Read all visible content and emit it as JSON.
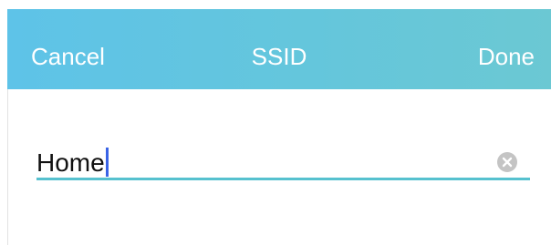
{
  "navbar": {
    "cancel_label": "Cancel",
    "title": "SSID",
    "done_label": "Done",
    "gradient_start": "#5ec3e8",
    "gradient_end": "#6bc8d3"
  },
  "field": {
    "value": "Home",
    "underline_color": "#56c1cf",
    "caret_color": "#3a64e6",
    "clear_icon": "clear-circle-x-icon"
  }
}
